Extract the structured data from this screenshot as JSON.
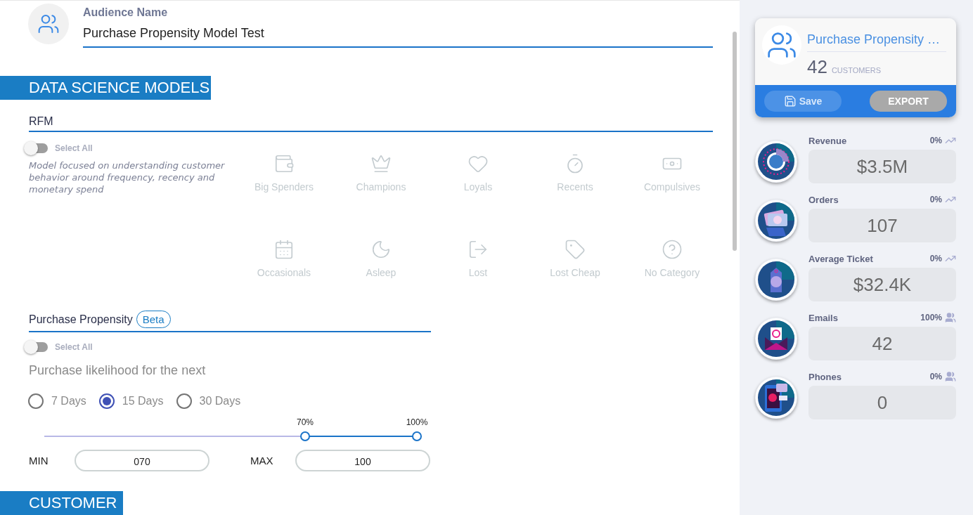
{
  "audience": {
    "label": "Audience Name",
    "value": "Purchase Propensity Model Test"
  },
  "section_title": "DATA SCIENCE MODELS",
  "rfm": {
    "title": "RFM",
    "select_all": {
      "label": "Select All",
      "on": false
    },
    "description": "Model focused on understanding customer behavior around frequency, recency and monetary spend",
    "segments": [
      {
        "label": "Big Spenders",
        "kind": "wallet",
        "selected": false
      },
      {
        "label": "Champions",
        "kind": "crown",
        "selected": false
      },
      {
        "label": "Loyals",
        "kind": "heart",
        "selected": false
      },
      {
        "label": "Recents",
        "kind": "timer",
        "selected": false
      },
      {
        "label": "Compulsives",
        "kind": "banknote",
        "selected": false
      },
      {
        "label": "Occasionals",
        "kind": "calendar",
        "selected": false
      },
      {
        "label": "Asleep",
        "kind": "moon",
        "selected": false
      },
      {
        "label": "Lost",
        "kind": "exit",
        "selected": false
      },
      {
        "label": "Lost Cheap",
        "kind": "tag",
        "selected": false
      },
      {
        "label": "No Category",
        "kind": "question",
        "selected": false
      }
    ]
  },
  "propensity": {
    "title": "Purchase Propensity",
    "badge": "Beta",
    "select_all": {
      "label": "Select All",
      "on": false
    },
    "prompt": "Purchase likelihood for the next",
    "periods": [
      {
        "label": "7 Days",
        "selected": false
      },
      {
        "label": "15 Days",
        "selected": true
      },
      {
        "label": "30 Days",
        "selected": false
      }
    ],
    "thumbs": [
      {
        "label": "70%",
        "level": 0.7
      },
      {
        "label": "100%",
        "level": 1
      }
    ],
    "min": {
      "label": "MIN",
      "value": "070"
    },
    "max": {
      "label": "MAX",
      "value": "100"
    }
  },
  "next_section_title": "CUSTOMER",
  "summary": {
    "name": "Purchase Propensity …",
    "count": "42",
    "count_label": "CUSTOMERS",
    "save": "Save",
    "export": "EXPORT"
  },
  "metrics": [
    {
      "label": "Revenue",
      "kind": "revenue",
      "percent": "0%",
      "value": "$3.5M"
    },
    {
      "label": "Orders",
      "kind": "orders",
      "percent": "0%",
      "value": "107"
    },
    {
      "label": "Average Ticket",
      "kind": "ticket",
      "percent": "0%",
      "value": "$32.4K"
    },
    {
      "label": "Emails",
      "kind": "email",
      "percent": "100%",
      "value": "42"
    },
    {
      "label": "Phones",
      "kind": "phone",
      "percent": "0%",
      "value": "0"
    }
  ]
}
